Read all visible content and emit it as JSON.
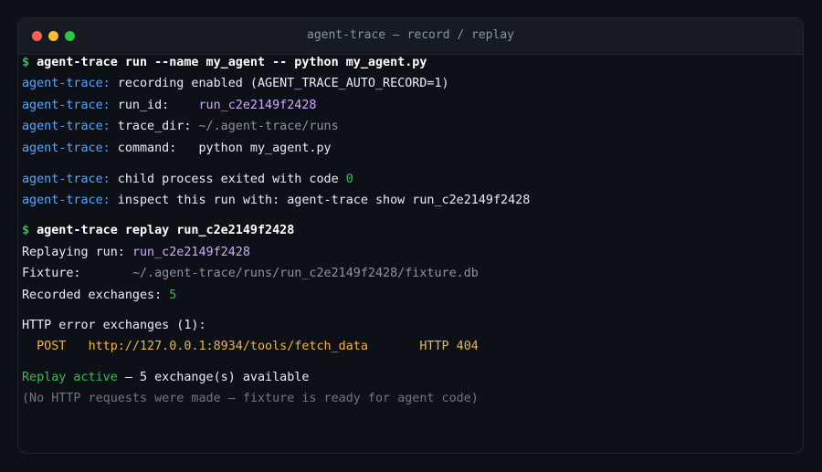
{
  "window": {
    "title": "agent-trace — record / replay"
  },
  "terminal": {
    "prompt": "$",
    "cmd1": "agent-trace run --name my_agent -- python my_agent.py",
    "tag": "agent-trace:",
    "l2": " recording enabled (AGENT_TRACE_AUTO_RECORD=1)",
    "l3_label": " run_id:    ",
    "l3_value": "run_c2e2149f2428",
    "l4_label": " trace_dir: ",
    "l4_value": "~/.agent-trace/runs",
    "l5_label": " command:   ",
    "l5_value": "python my_agent.py",
    "l6_label": " child process exited with code ",
    "l6_value": "0",
    "l7": " inspect this run with: agent-trace show run_c2e2149f2428",
    "cmd2": "agent-trace replay run_c2e2149f2428",
    "replaying_label": "Replaying run: ",
    "replaying_value": "run_c2e2149f2428",
    "fixture_label": "Fixture:       ",
    "fixture_value": "~/.agent-trace/runs/run_c2e2149f2428/fixture.db",
    "recorded_label": "Recorded exchanges: ",
    "recorded_value": "5",
    "http_errors_header": "HTTP error exchanges (1):",
    "err_method": "POST",
    "err_url": "http://127.0.0.1:8934/tools/fetch_data",
    "err_status": "HTTP 404",
    "replay_active": "Replay active",
    "replay_rest": " — 5 exchange(s) available",
    "no_http": "(No HTTP requests were made — fixture is ready for agent code)"
  },
  "colors": {
    "background": "#0d1117",
    "titlebar": "#161b22",
    "prompt_green": "#3fb950",
    "tag_blue": "#58a6ff",
    "value_purple": "#d2a8ff",
    "url_orange": "#f0b442",
    "dim_grey": "#8b949e"
  }
}
